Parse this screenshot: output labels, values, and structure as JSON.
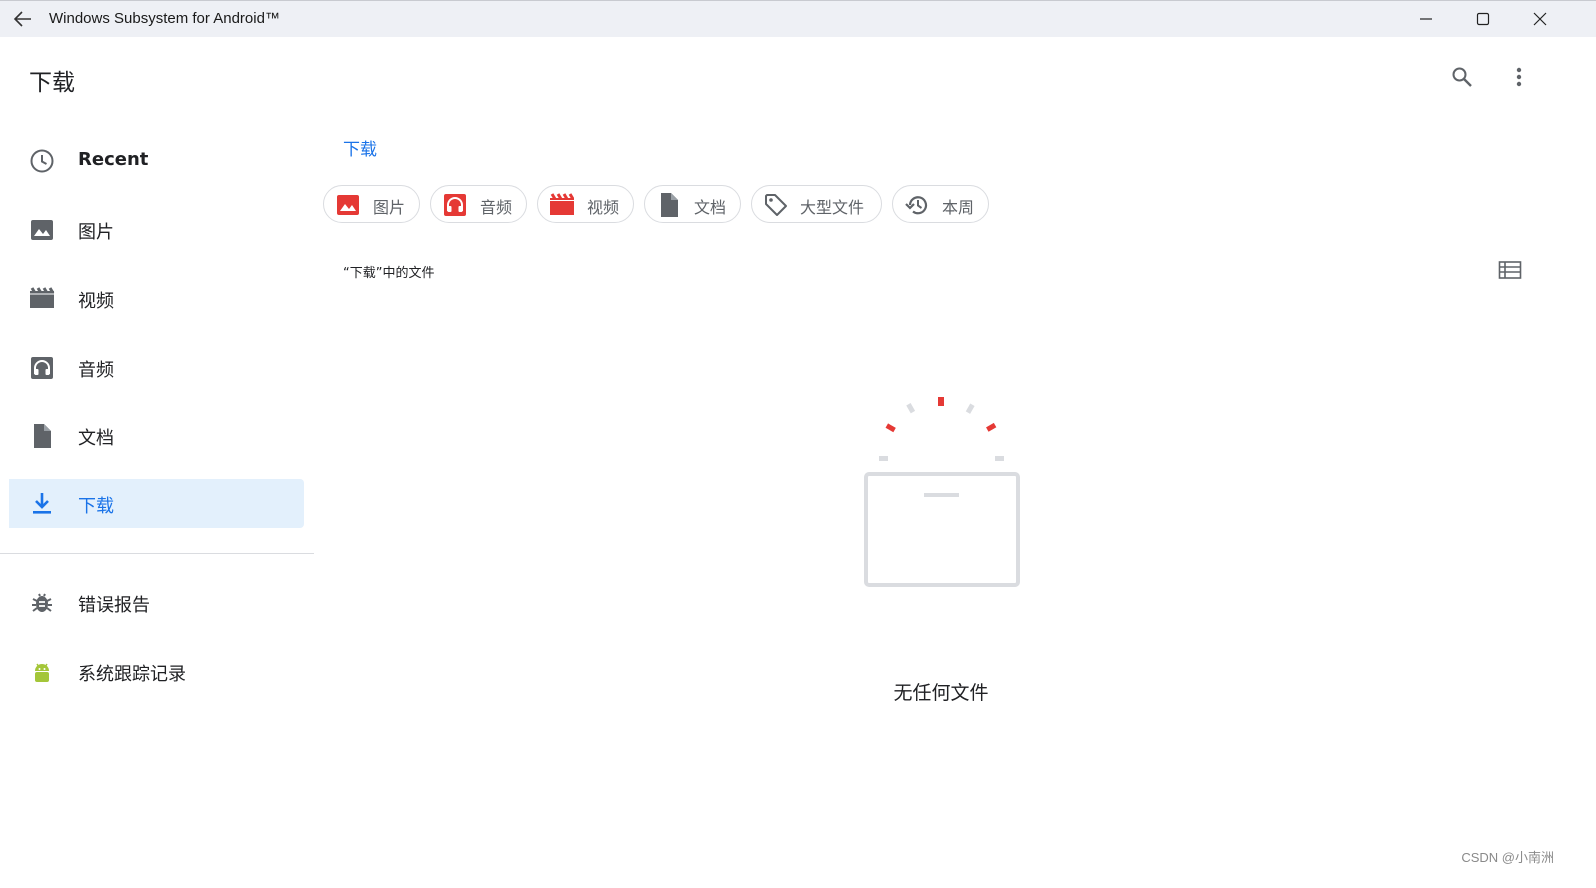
{
  "window": {
    "title": "Windows Subsystem for Android™"
  },
  "appbar": {
    "title": "下载"
  },
  "nav": {
    "items": [
      {
        "label": "Recent",
        "icon": "clock-icon"
      },
      {
        "label": "图片",
        "icon": "image-icon"
      },
      {
        "label": "视频",
        "icon": "movie-icon"
      },
      {
        "label": "音频",
        "icon": "headphones-icon"
      },
      {
        "label": "文档",
        "icon": "document-icon"
      },
      {
        "label": "下载",
        "icon": "download-icon",
        "active": true
      }
    ],
    "secondary": [
      {
        "label": "错误报告",
        "icon": "bug-icon"
      },
      {
        "label": "系统跟踪记录",
        "icon": "android-icon"
      }
    ]
  },
  "breadcrumb": "下载",
  "chips": [
    {
      "label": "图片",
      "icon": "image-icon"
    },
    {
      "label": "音频",
      "icon": "headphones-icon"
    },
    {
      "label": "视频",
      "icon": "movie-icon"
    },
    {
      "label": "文档",
      "icon": "document-icon"
    },
    {
      "label": "大型文件",
      "icon": "tag-icon"
    },
    {
      "label": "本周",
      "icon": "history-icon"
    }
  ],
  "section": {
    "title": "“下载”中的文件"
  },
  "empty": {
    "message": "无任何文件"
  },
  "watermark": "CSDN @小南洲",
  "colors": {
    "accent": "#1a73e8",
    "active_bg": "#e3f0fc",
    "chip_icon_red": "#e53935",
    "icon_gray": "#5f6368",
    "android_green": "#a4c639"
  }
}
